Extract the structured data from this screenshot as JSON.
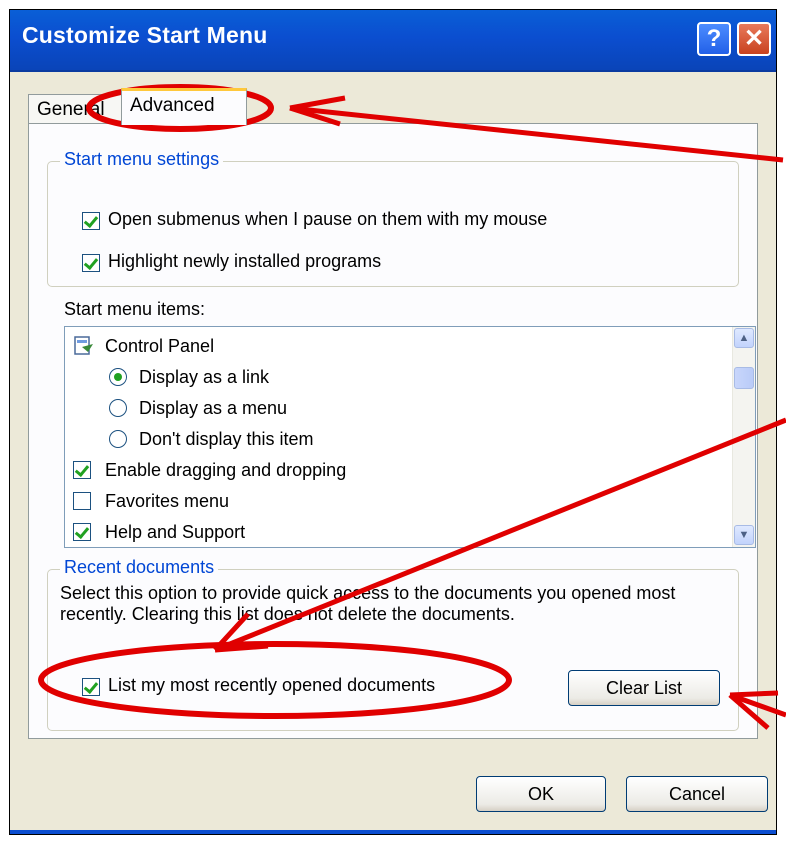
{
  "window": {
    "title": "Customize Start Menu",
    "help_glyph": "?",
    "close_glyph": "✕"
  },
  "tabs": [
    {
      "label": "General"
    },
    {
      "label": "Advanced",
      "active": true
    }
  ],
  "start_menu_settings": {
    "title": "Start menu settings",
    "options": [
      {
        "label": "Open submenus when I pause on them with my mouse",
        "checked": true
      },
      {
        "label": "Highlight newly installed programs",
        "checked": true
      }
    ]
  },
  "start_menu_items": {
    "label": "Start menu items:",
    "items": [
      {
        "type": "header",
        "label": "Control Panel",
        "icon": "control-panel-icon"
      },
      {
        "type": "radio",
        "label": "Display as a link",
        "selected": true
      },
      {
        "type": "radio",
        "label": "Display as a menu",
        "selected": false
      },
      {
        "type": "radio",
        "label": "Don't display this item",
        "selected": false
      },
      {
        "type": "check",
        "label": "Enable dragging and dropping",
        "checked": true
      },
      {
        "type": "check",
        "label": "Favorites menu",
        "checked": false
      },
      {
        "type": "check",
        "label": "Help and Support",
        "checked": true
      }
    ]
  },
  "recent_documents": {
    "title": "Recent documents",
    "description": "Select this option to provide quick access to the documents you opened most recently. Clearing this list does not delete the documents.",
    "option": {
      "label": "List my most recently opened documents",
      "checked": true
    },
    "clear_label": "Clear List"
  },
  "footer": {
    "ok_label": "OK",
    "cancel_label": "Cancel"
  },
  "colors": {
    "titlebar": "#0b4ed0",
    "group_title": "#0046d5",
    "annotation": "#e00000",
    "check": "#21a121"
  }
}
